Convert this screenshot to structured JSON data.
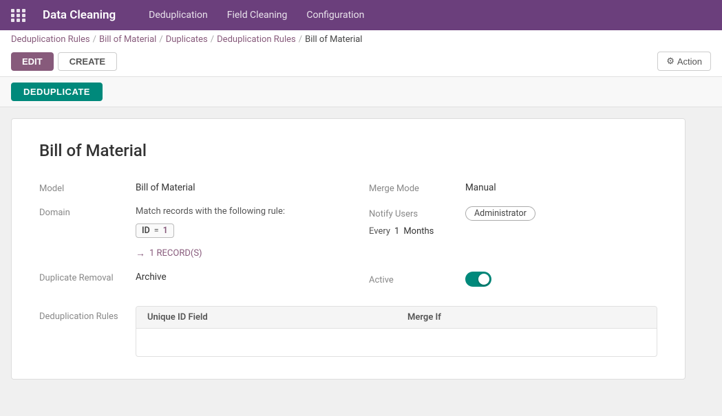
{
  "app": {
    "title": "Data Cleaning",
    "nav_items": [
      "Deduplication",
      "Field Cleaning",
      "Configuration"
    ]
  },
  "breadcrumb": {
    "items": [
      {
        "label": "Deduplication Rules",
        "href": "#"
      },
      {
        "label": "Bill of Material",
        "href": "#"
      },
      {
        "label": "Duplicates",
        "href": "#"
      },
      {
        "label": "Deduplication Rules",
        "href": "#"
      },
      {
        "label": "Bill of Material",
        "href": "#",
        "current": true
      }
    ]
  },
  "toolbar": {
    "edit_label": "EDIT",
    "create_label": "CREATE",
    "action_label": "Action"
  },
  "dedup_bar": {
    "deduplicate_label": "DEDUPLICATE"
  },
  "record": {
    "title": "Bill of Material",
    "model_label": "Model",
    "model_value": "Bill of Material",
    "domain_label": "Domain",
    "domain_match_text": "Match records with the following rule:",
    "domain_filter": {
      "key": "ID",
      "op": "=",
      "val": "1"
    },
    "records_link": "1 RECORD(S)",
    "duplicate_removal_label": "Duplicate Removal",
    "duplicate_removal_value": "Archive",
    "deduplication_rules_label": "Deduplication Rules",
    "table_col1": "Unique ID Field",
    "table_col2": "Merge If",
    "merge_mode_label": "Merge Mode",
    "merge_mode_value": "Manual",
    "notify_users_label": "Notify Users",
    "notify_users_badge": "Administrator",
    "every_label": "Every",
    "every_value": "1",
    "months_label": "Months",
    "active_label": "Active"
  }
}
